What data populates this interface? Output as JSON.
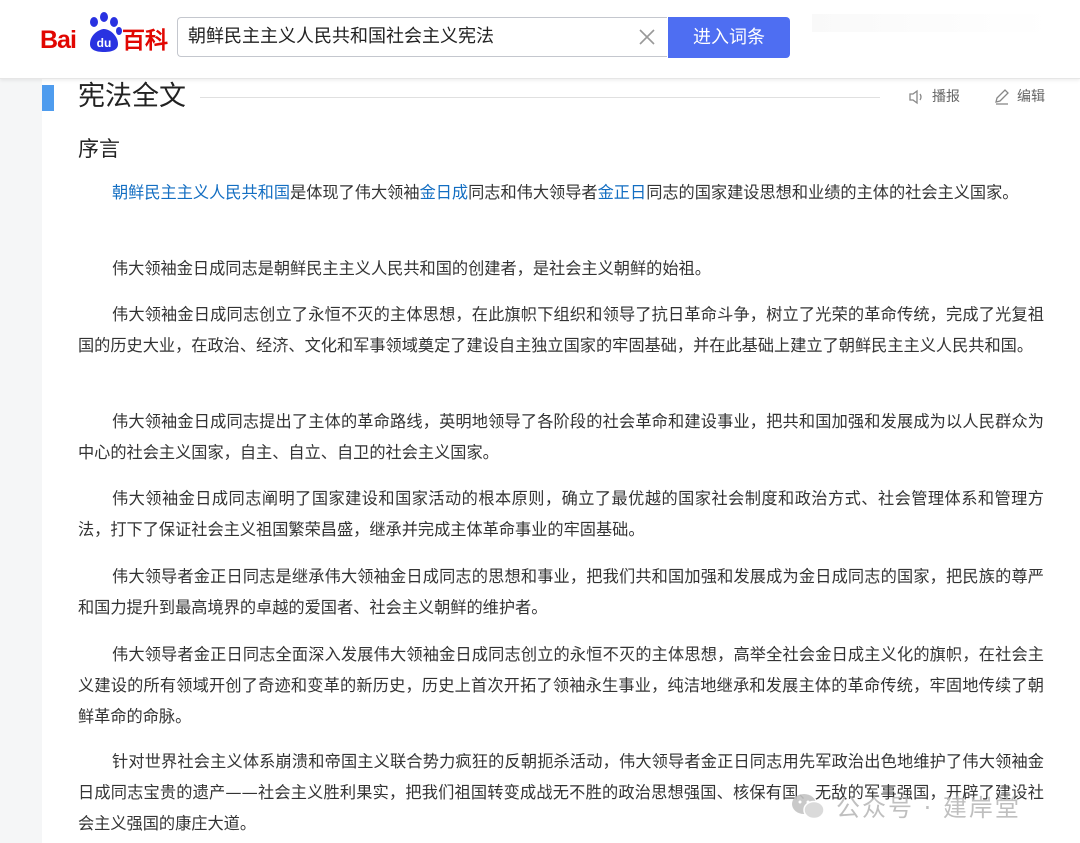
{
  "header": {
    "logo_text_bai": "Bai",
    "logo_text_du": "du",
    "logo_text_baike": "百科",
    "search_value": "朝鲜民主主义人民共和国社会主义宪法",
    "search_button_label": "进入词条",
    "brand_color": "#e10601",
    "accent_color": "#4e6ef2"
  },
  "section": {
    "title": "宪法全文",
    "play_label": "播报",
    "edit_label": "编辑",
    "subtitle": "序言"
  },
  "paragraphs": {
    "p1": {
      "link1": "朝鲜民主主义人民共和国",
      "text1": "是体现了伟大领袖",
      "link2": "金日成",
      "text2": "同志和伟大领导者",
      "link3": "金正日",
      "text3": "同志的国家建设思想和业绩的主体的社会主义国家。"
    },
    "p2": "伟大领袖金日成同志是朝鲜民主主义人民共和国的创建者，是社会主义朝鲜的始祖。",
    "p3": "伟大领袖金日成同志创立了永恒不灭的主体思想，在此旗帜下组织和领导了抗日革命斗争，树立了光荣的革命传统，完成了光复祖国的历史大业，在政治、经济、文化和军事领域奠定了建设自主独立国家的牢固基础，并在此基础上建立了朝鲜民主主义人民共和国。",
    "p4": "伟大领袖金日成同志提出了主体的革命路线，英明地领导了各阶段的社会革命和建设事业，把共和国加强和发展成为以人民群众为中心的社会主义国家，自主、自立、自卫的社会主义国家。",
    "p5": "伟大领袖金日成同志阐明了国家建设和国家活动的根本原则，确立了最优越的国家社会制度和政治方式、社会管理体系和管理方法，打下了保证社会主义祖国繁荣昌盛，继承并完成主体革命事业的牢固基础。",
    "p6": "伟大领导者金正日同志是继承伟大领袖金日成同志的思想和事业，把我们共和国加强和发展成为金日成同志的国家，把民族的尊严和国力提升到最高境界的卓越的爱国者、社会主义朝鲜的维护者。",
    "p7": "伟大领导者金正日同志全面深入发展伟大领袖金日成同志创立的永恒不灭的主体思想，高举全社会金日成主义化的旗帜，在社会主义建设的所有领域开创了奇迹和变革的新历史，历史上首次开拓了领袖永生事业，纯洁地继承和发展主体的革命传统，牢固地传续了朝鲜革命的命脉。",
    "p8": "针对世界社会主义体系崩溃和帝国主义联合势力疯狂的反朝扼杀活动，伟大领导者金正日同志用先军政治出色地维护了伟大领袖金日成同志宝贵的遗产——社会主义胜利果实，把我们祖国转变成战无不胜的政治思想强国、核保有国、无敌的军事强国，开辟了建设社会主义强国的康庄大道。"
  },
  "watermark": {
    "text": "公众号 · 建岸堂"
  },
  "colors": {
    "link": "#136ec2",
    "section_bar": "#4f9cee"
  },
  "icons": [
    "baidu-paw-icon",
    "clear-icon",
    "speaker-icon",
    "pencil-icon",
    "wechat-icon"
  ]
}
